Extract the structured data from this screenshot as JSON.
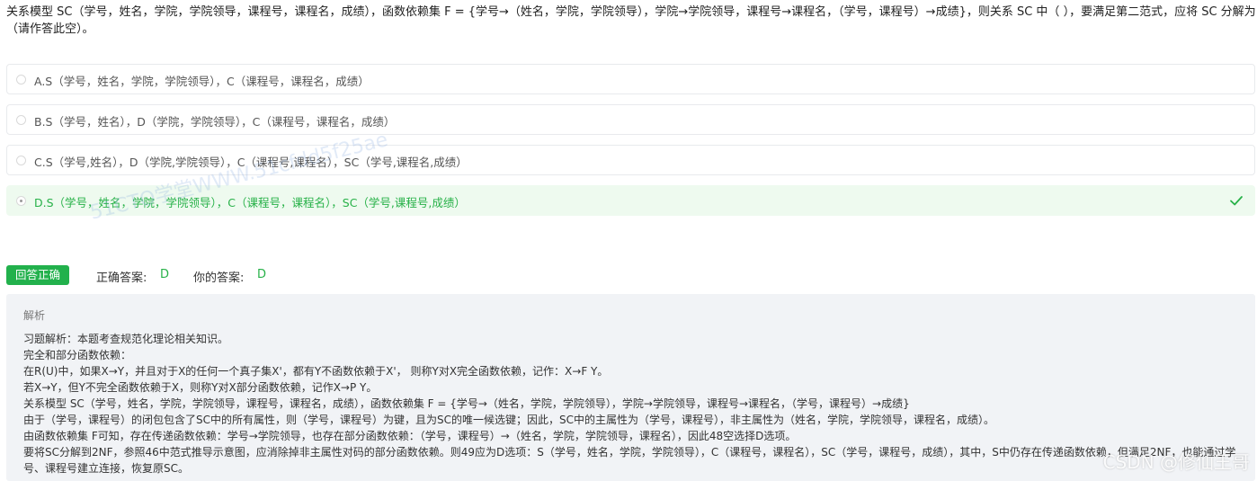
{
  "question": {
    "text": "关系模型 SC（学号，姓名，学院，学院领导，课程号，课程名，成绩），函数依赖集 F = {学号→（姓名，学院，学院领导），学院→学院领导，课程号→课程名，（学号，课程号）→成绩}，则关系 SC 中（ ），要满足第二范式，应将 SC 分解为（请作答此空）。"
  },
  "options": [
    {
      "label": "A.S（学号，姓名，学院，学院领导），C（课程号，课程名，成绩）",
      "selected": false,
      "correct": false
    },
    {
      "label": "B.S（学号，姓名），D（学院，学院领导），C（课程号，课程名，成绩）",
      "selected": false,
      "correct": false
    },
    {
      "label": "C.S（学号,姓名），D（学院,学院领导），C（课程号,课程名），SC（学号,课程名,成绩）",
      "selected": false,
      "correct": false
    },
    {
      "label": "D.S（学号，姓名，学院，学院领导），C（课程号，课程名），SC（学号,课程号,成绩）",
      "selected": true,
      "correct": true
    }
  ],
  "watermark": "51CTO学堂WWW.51cfdd5f25ae",
  "result": {
    "badge": "回答正确",
    "correct_answer_label": "正确答案:",
    "correct_answer": "D",
    "your_answer_label": "你的答案:",
    "your_answer": "D"
  },
  "analysis": {
    "title": "解析",
    "lines": [
      "习题解析：本题考查规范化理论相关知识。",
      "完全和部分函数依赖：",
      "在R(U)中，如果X→Y，并且对于X的任何一个真子集X'，都有Y不函数依赖于X'， 则称Y对X完全函数依赖，记作：X→F Y。",
      "若X→Y，但Y不完全函数依赖于X，则称Y对X部分函数依赖，记作X→P Y。",
      "关系模型 SC（学号，姓名，学院，学院领导，课程号，课程名，成绩），函数依赖集 F = {学号→（姓名，学院，学院领导），学院→学院领导，课程号→课程名，（学号，课程号）→成绩}",
      "由于（学号，课程号）的闭包包含了SC中的所有属性，则（学号，课程号）为键，且为SC的唯一候选键；因此，SC中的主属性为（学号，课程号），非主属性为（姓名，学院，学院领导，课程名，成绩）。",
      "由函数依赖集 F可知，存在传递函数依赖：学号→学院领导，也存在部分函数依赖：（学号，课程号）→（姓名，学院，学院领导，课程名），因此48空选择D选项。",
      "要将SC分解到2NF，参照46中范式推导示意图，应消除掉非主属性对码的部分函数依赖。则49应为D选项：S（学号，姓名，学院，学院领导），C（课程号，课程名），SC（学号，课程号，成绩），其中，S中仍存在传递函数依赖，但满足2NF，也能通过学号、课程号建立连接，恢复原SC。"
    ]
  },
  "footer_watermark": "CSDN @修仙王哥",
  "colors": {
    "accent": "#22b14c",
    "correct_bg": "#eefaef",
    "analysis_bg": "#f1f3f6"
  }
}
